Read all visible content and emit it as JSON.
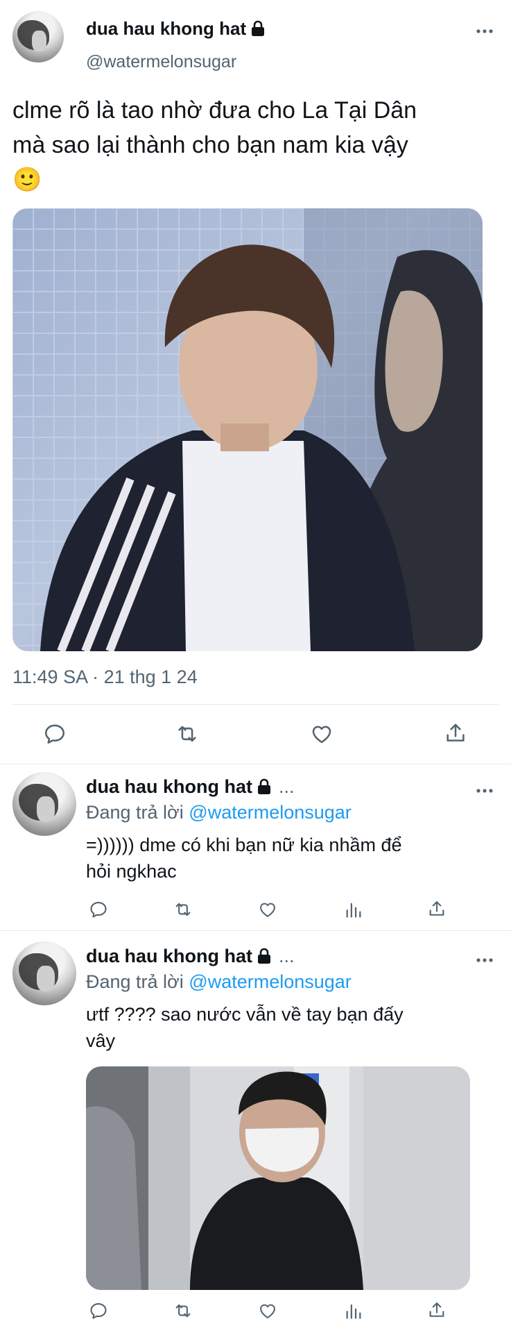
{
  "main_tweet": {
    "display_name": "dua hau khong hat",
    "handle": "@watermelonsugar",
    "text_line1": "clme rõ là tao nhờ đưa cho La Tại Dân",
    "text_line2": "mà sao lại thành cho bạn nam kia vậy",
    "emoji": "🙂",
    "timestamp": "11:49 SA · 21 thg 1 24"
  },
  "replies": [
    {
      "display_name": "dua hau khong hat",
      "ellipsis": "...",
      "replying_prefix": "Đang trả lời",
      "replying_to": "@watermelonsugar",
      "text_line1": "=)))))) dme có khi bạn nữ kia nhầm để",
      "text_line2": "hỏi ngkhac"
    },
    {
      "display_name": "dua hau khong hat",
      "ellipsis": "...",
      "replying_prefix": "Đang trả lời",
      "replying_to": "@watermelonsugar",
      "text_line1": "ưtf ???? sao nước vẫn về tay bạn đấy",
      "text_line2": "vây"
    }
  ],
  "colors": {
    "text": "#0f1419",
    "secondary": "#536471",
    "link": "#1d9bf0",
    "divider": "#e1e8ed"
  },
  "icons": [
    "more-icon",
    "lock-icon",
    "reply-icon",
    "retweet-icon",
    "like-icon",
    "views-icon",
    "share-icon"
  ]
}
